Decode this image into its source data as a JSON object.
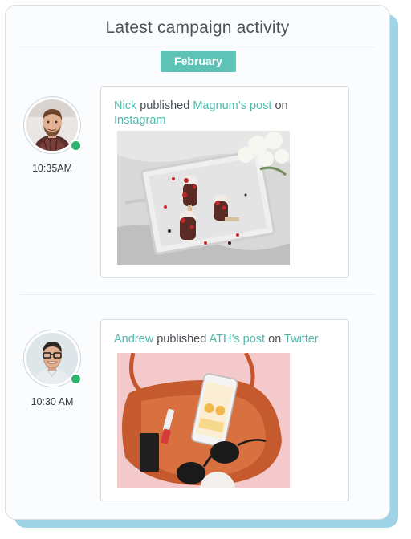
{
  "panel": {
    "title": "Latest campaign activity",
    "month_badge": "February"
  },
  "activities": [
    {
      "user": "Nick",
      "action": "published",
      "target": "Magnum’s post",
      "preposition": "on",
      "platform": "Instagram",
      "time": "10:35AM",
      "status": "online"
    },
    {
      "user": "Andrew",
      "action": "published",
      "target": "ATH’s post",
      "preposition": "on",
      "platform": "Twitter",
      "time": "10:30 AM",
      "status": "online"
    }
  ],
  "colors": {
    "accent": "#5cc3b6",
    "link": "#4fb8ab",
    "online": "#2cb46e",
    "shadow": "#9fd3e6"
  }
}
